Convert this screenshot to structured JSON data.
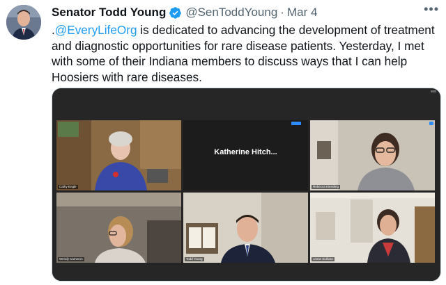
{
  "tweet": {
    "author_name": "Senator Todd Young",
    "handle": "@SenToddYoung",
    "separator": "·",
    "date": "Mar 4",
    "more_icon": "more-dots-icon",
    "verified_icon": "verified-badge-icon",
    "text_prefix": ".",
    "mention": "@EveryLifeOrg",
    "text_body": " is dedicated to advancing the development of treatment and diagnostic opportunities for rare disease patients. Yesterday, I met with some of their Indiana members to discuss ways that I can help Hoosiers with rare diseases."
  },
  "video_call": {
    "center_label": "Katherine  Hitch...",
    "participants": [
      {
        "label": "Cathy Engle"
      },
      {
        "label": "Katherine Hitch..."
      },
      {
        "label": "Rebecca Kiessling"
      },
      {
        "label": "Wendy Cameron"
      },
      {
        "label": "Todd Young"
      },
      {
        "label": "Jamie Sullivan"
      }
    ]
  },
  "colors": {
    "link": "#1d9bf0",
    "verified": "#1d9bf0",
    "active_speaker": "#bde04e"
  }
}
